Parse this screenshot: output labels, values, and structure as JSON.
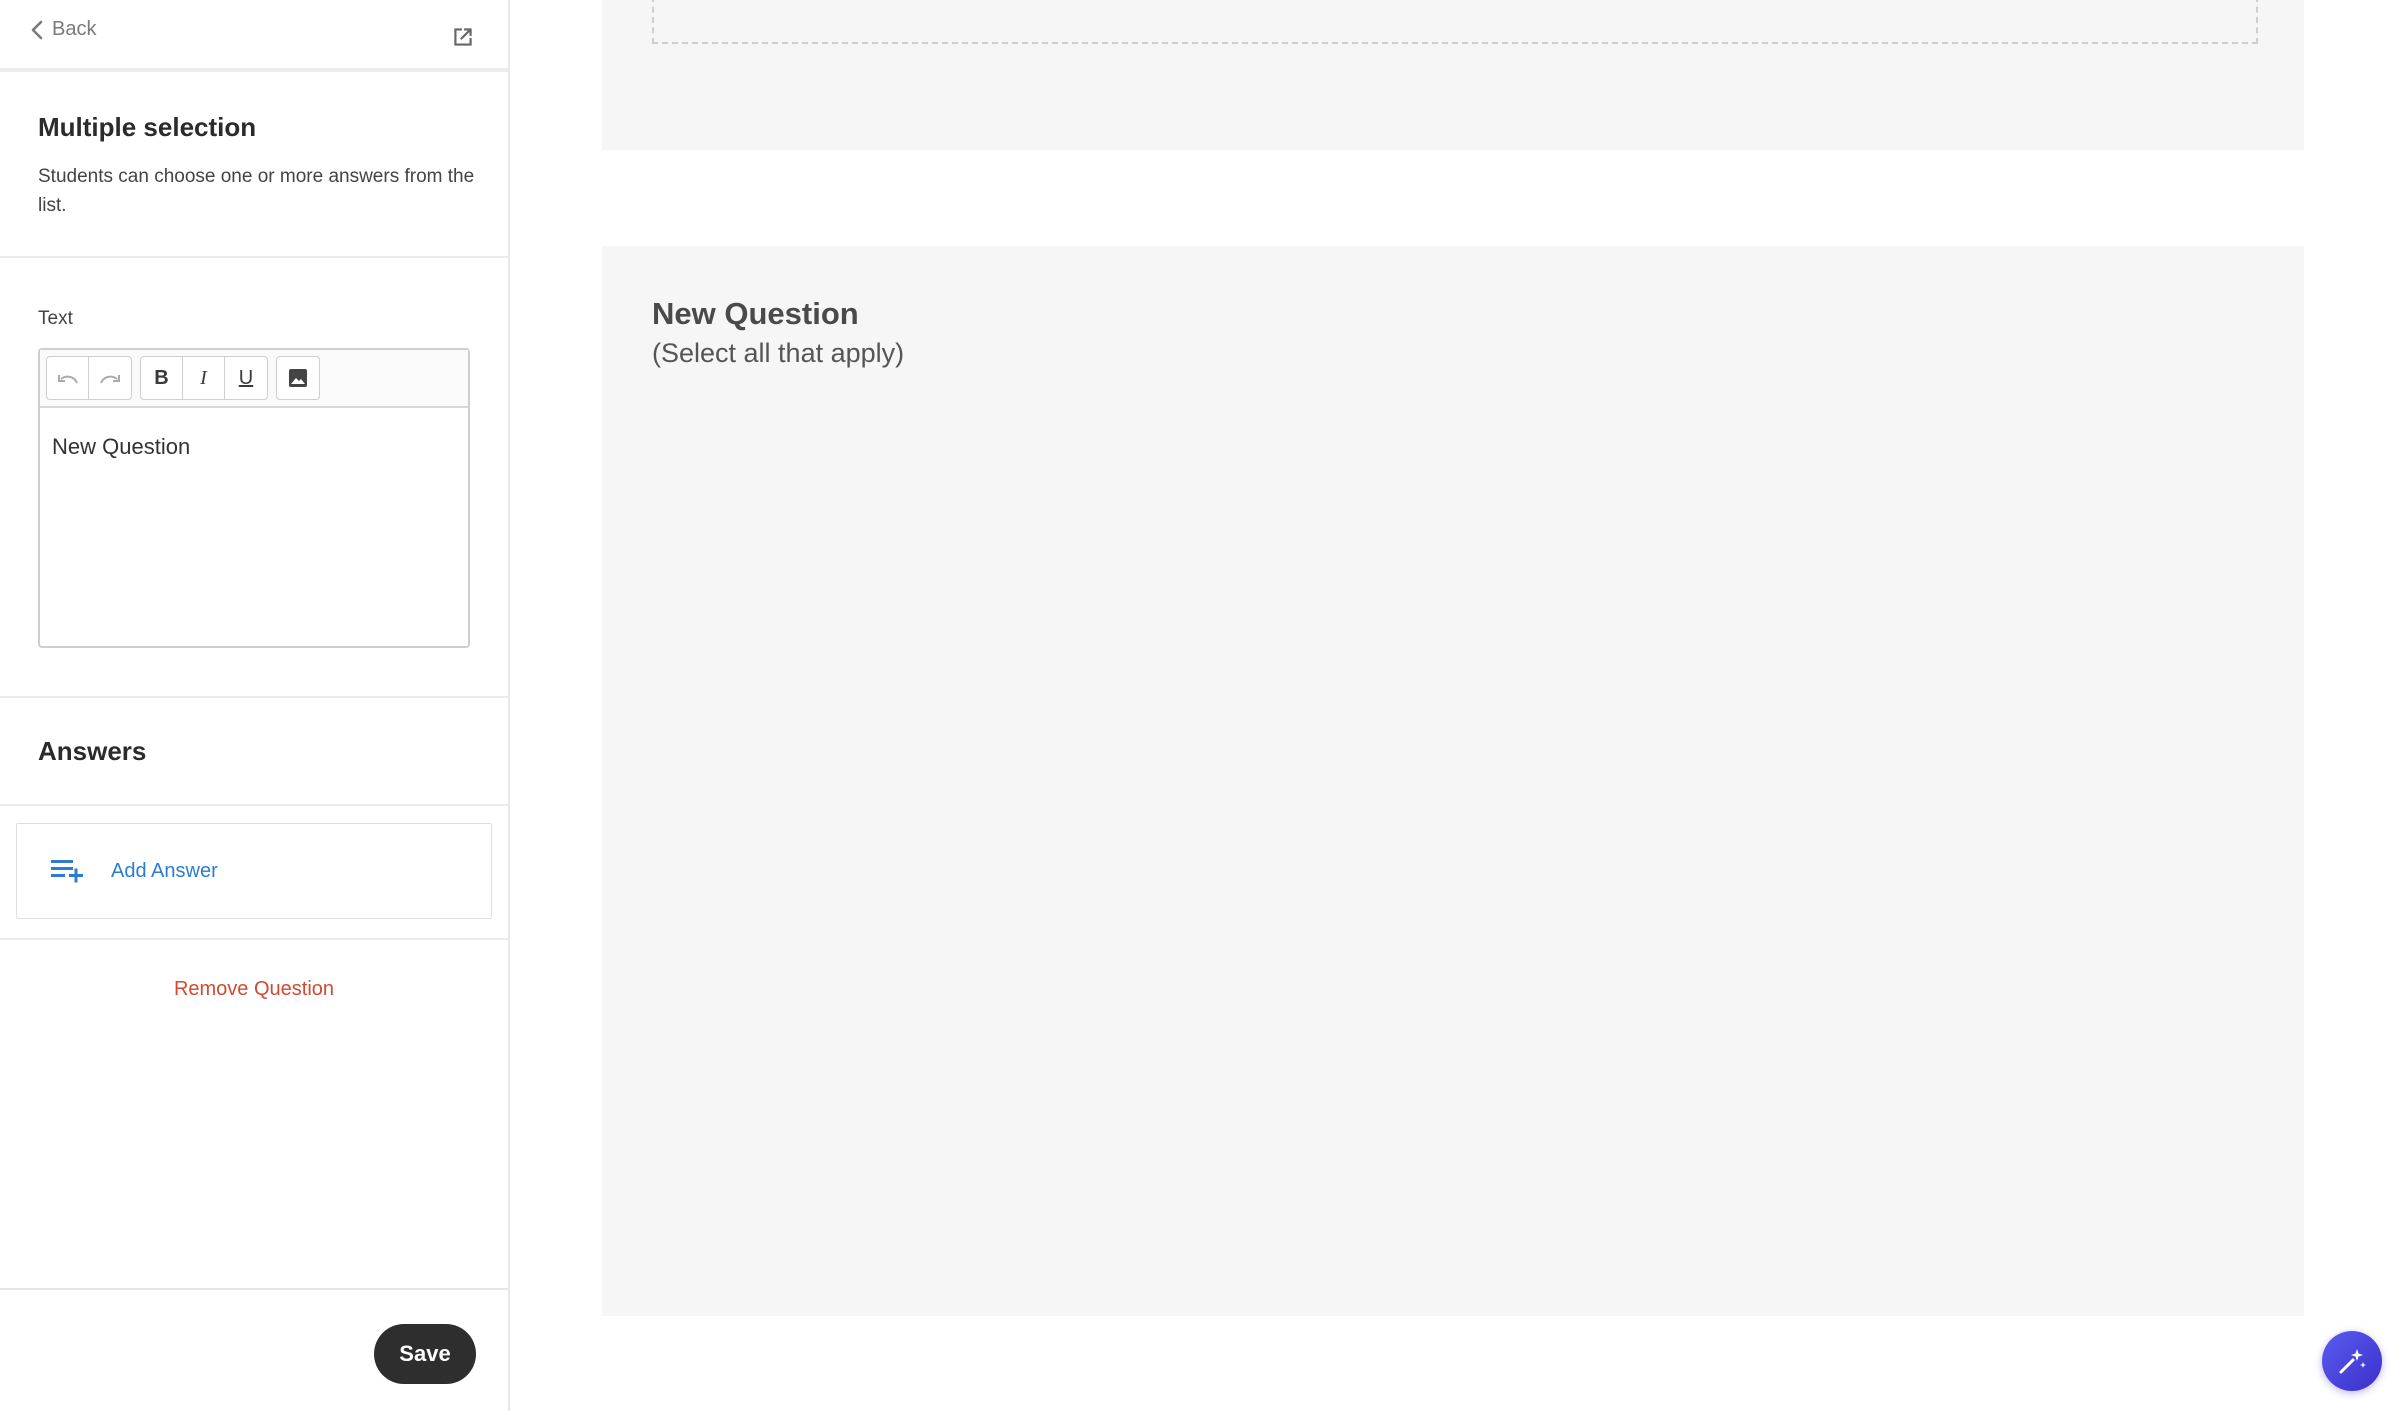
{
  "sidebar": {
    "back_label": "Back",
    "type_section": {
      "title": "Multiple selection",
      "description": "Students can choose one or more answers from the list."
    },
    "text_section": {
      "label": "Text",
      "editor_content": "New Question",
      "toolbar": {
        "bold": "B",
        "italic": "I",
        "underline": "U"
      }
    },
    "answers_section": {
      "title": "Answers",
      "add_answer_label": "Add Answer"
    },
    "remove_question_label": "Remove Question",
    "save_label": "Save"
  },
  "preview": {
    "question_title": "New Question",
    "question_hint": "(Select all that apply)"
  },
  "colors": {
    "link_blue": "#2c7cd1",
    "danger_red": "#d14a32",
    "save_dark": "#2e2e2e",
    "card_bg": "#f6f6f7",
    "fab_purple": "#4a45e0"
  },
  "icons": {
    "back": "chevron-left-icon",
    "popout": "open-in-new-icon",
    "undo": "undo-icon",
    "redo": "redo-icon",
    "image": "image-icon",
    "add_answer": "playlist-add-icon",
    "fab": "sparkle-wand-icon"
  }
}
